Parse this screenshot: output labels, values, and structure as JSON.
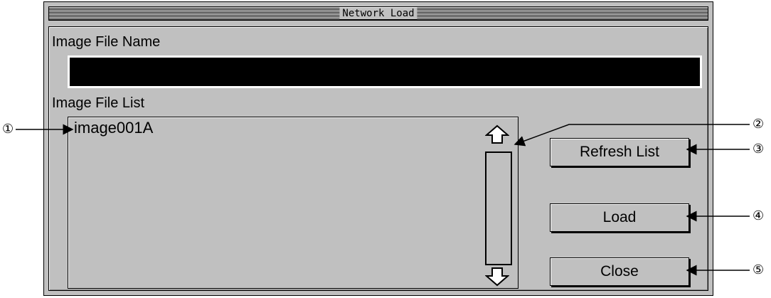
{
  "window": {
    "title": "Network Load"
  },
  "image_file_name": {
    "label": "Image File Name",
    "value": ""
  },
  "image_file_list": {
    "label": "Image File List",
    "items": [
      "image001A"
    ]
  },
  "buttons": {
    "refresh": "Refresh List",
    "load": "Load",
    "close": "Close"
  },
  "callouts": [
    "①",
    "②",
    "③",
    "④",
    "⑤"
  ]
}
